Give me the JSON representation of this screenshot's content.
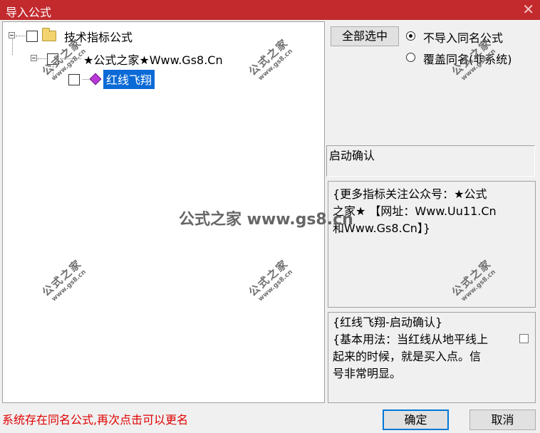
{
  "window": {
    "title": "导入公式",
    "close_glyph": "✕"
  },
  "tree": {
    "root_label": "技术指标公式",
    "group_label": "★公式之家★Www.Gs8.Cn",
    "item_label": "红线飞翔",
    "item_icon": "purple-gem-icon"
  },
  "buttons": {
    "select_all": "全部选中",
    "confirm": "确定",
    "cancel": "取消"
  },
  "options": {
    "no_import_same": "不导入同名公式",
    "overwrite_same": "覆盖同名(非系统)",
    "selected": "no_import_same"
  },
  "panels": {
    "name_box": "启动确认",
    "description_lines": [
      "{更多指标关注公众号：★公式",
      "之家★ 【网址：Www.Uu11.Cn",
      "和Www.Gs8.Cn】}"
    ],
    "usage_lines": [
      "{红线飞翔-启动确认}",
      "{基本用法：当红线从地平线上",
      "起来的时候，就是买入点。信",
      "号非常明显。"
    ]
  },
  "status": {
    "message": "系统存在同名公式,再次点击可以更名"
  },
  "watermark": {
    "main": "公式之家",
    "url": "www.gs8.cn",
    "center": "公式之家 www.gs8.cn"
  }
}
